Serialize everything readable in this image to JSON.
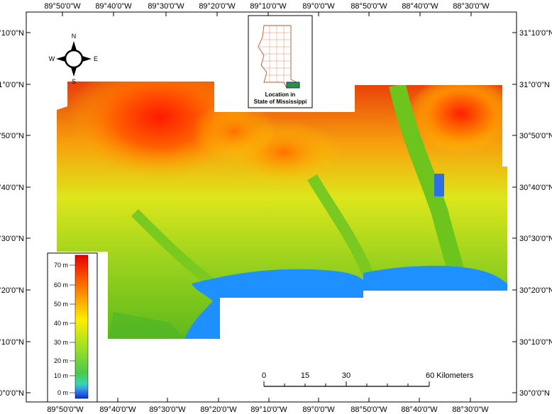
{
  "map": {
    "longitude_ticks": [
      "89°50'0\"W",
      "89°40'0\"W",
      "89°30'0\"W",
      "89°20'0\"W",
      "89°10'0\"W",
      "89°0'0\"W",
      "88°50'0\"W",
      "88°40'0\"W",
      "88°30'0\"W"
    ],
    "latitude_ticks": [
      "31°10'0\"N",
      "31°0'0\"N",
      "30°50'0\"N",
      "30°40'0\"N",
      "30°30'0\"N",
      "30°20'0\"N",
      "30°10'0\"N",
      "30°0'0\"N"
    ],
    "inset_caption_line1": "Location in",
    "inset_caption_line2": "State of Mississippi",
    "north_arrow": {
      "n": "N",
      "s": "S",
      "e": "E",
      "w": "W",
      "icon": "north-arrow-icon"
    },
    "scale_bar": {
      "labels": [
        "0",
        "15",
        "30",
        "60 Kilometers"
      ],
      "values_km": [
        0,
        15,
        30,
        60
      ]
    },
    "legend": {
      "labels": [
        "70 m",
        "60 m",
        "50 m",
        "40 m",
        "30 m",
        "20 m",
        "10 m",
        "0 m"
      ],
      "values_m": [
        70,
        60,
        50,
        40,
        30,
        20,
        10,
        0
      ],
      "colors": [
        "#ff0000",
        "#ff7f00",
        "#ffff00",
        "#7fff00",
        "#00ff7f",
        "#00aaff",
        "#0000ff"
      ]
    },
    "colors": {
      "water": "#1e90ff",
      "low": "#5dbb1e",
      "mid": "#c8e62a",
      "high": "#ff2a00"
    }
  }
}
